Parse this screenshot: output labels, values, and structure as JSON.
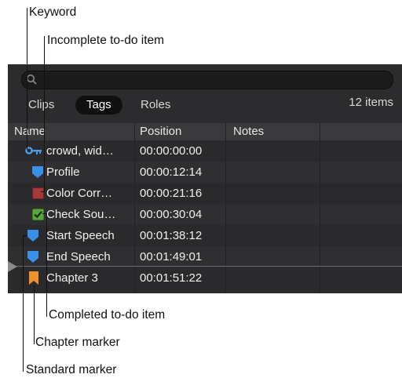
{
  "callouts": {
    "keyword": "Keyword",
    "incomplete": "Incomplete to-do item",
    "completed": "Completed to-do item",
    "chapter": "Chapter marker",
    "standard": "Standard marker"
  },
  "tabs": {
    "clips": "Clips",
    "tags": "Tags",
    "roles": "Roles"
  },
  "count": "12 items",
  "columns": {
    "name": "Name",
    "position": "Position",
    "notes": "Notes"
  },
  "rows": [
    {
      "icon": "keyword-icon",
      "name": "crowd, wid…",
      "position": "00:00:00:00",
      "notes": ""
    },
    {
      "icon": "standard-marker-icon",
      "name": "Profile",
      "position": "00:00:12:14",
      "notes": ""
    },
    {
      "icon": "incomplete-todo-icon",
      "name": "Color Corr…",
      "position": "00:00:21:16",
      "notes": ""
    },
    {
      "icon": "completed-todo-icon",
      "name": "Check Sou…",
      "position": "00:00:30:04",
      "notes": ""
    },
    {
      "icon": "standard-marker-icon",
      "name": "Start Speech",
      "position": "00:01:38:12",
      "notes": ""
    },
    {
      "icon": "standard-marker-icon",
      "name": "End Speech",
      "position": "00:01:49:01",
      "notes": ""
    },
    {
      "icon": "chapter-marker-icon",
      "name": "Chapter 3",
      "position": "00:01:51:22",
      "notes": ""
    }
  ],
  "colors": {
    "keyword": "#4a9de8",
    "standard_marker": "#3a8fe6",
    "incomplete_todo": "#a33a3a",
    "completed_todo": "#5aa83c",
    "chapter_marker": "#f0922a"
  }
}
